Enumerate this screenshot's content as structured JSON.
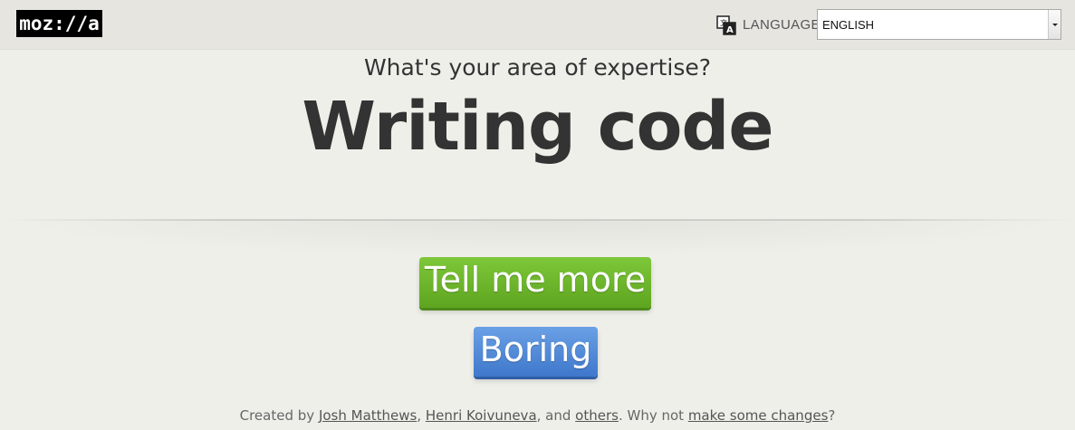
{
  "header": {
    "logo_text": "moz://a",
    "language_icon": "translate-icon",
    "language_label": "LANGUAGE:",
    "language_selected": "ENGLISH"
  },
  "hero": {
    "question": "What's your area of expertise?",
    "answer": "Writing code"
  },
  "actions": {
    "more_label": "Tell me more",
    "boring_label": "Boring"
  },
  "footer": {
    "prefix": "Created by ",
    "author1": "Josh Matthews",
    "sep1": ", ",
    "author2": "Henri Koivuneva",
    "sep2": ", and ",
    "others": "others",
    "middle": ". Why not ",
    "changes": "make some changes",
    "suffix": "?"
  },
  "colors": {
    "more_button": "#6cb52a",
    "boring_button": "#4f88d8",
    "background": "#efefea"
  }
}
